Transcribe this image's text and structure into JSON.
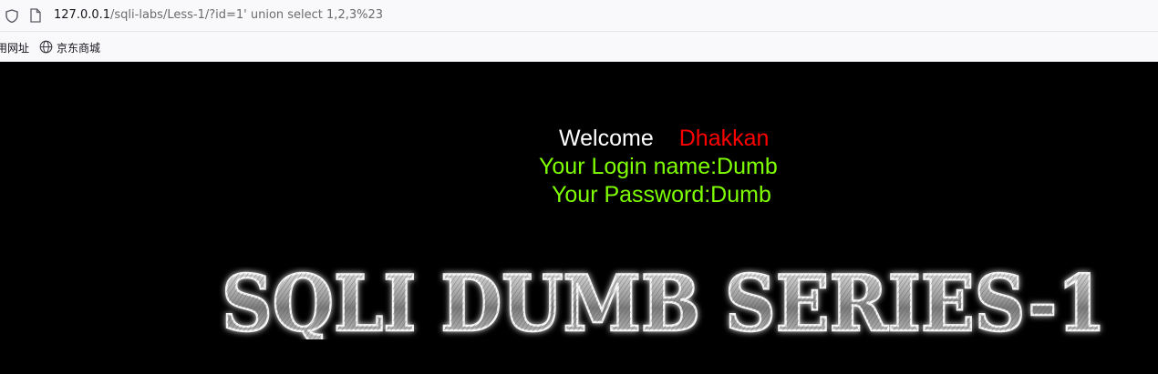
{
  "browser": {
    "url_host": "127.0.0.1",
    "url_path": "/sqli-labs/Less-1/?id=1' union select 1,2,3%23",
    "bookmarks": [
      "用网址",
      "京东商城"
    ]
  },
  "page": {
    "welcome_word": "Welcome",
    "welcome_user": "Dhakkan",
    "login_line": "Your Login name:Dumb",
    "password_line": "Your Password:Dumb",
    "banner": "SQLI DUMB SERIES-1"
  },
  "colors": {
    "background": "#000000",
    "welcome": "#ffffff",
    "user": "#ff0000",
    "info": "#7fff00"
  }
}
